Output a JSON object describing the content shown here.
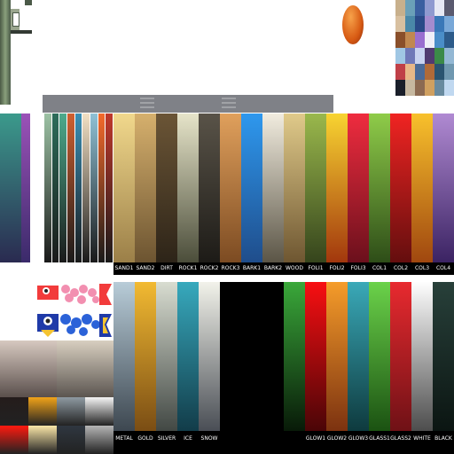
{
  "top_palette": {
    "labels": [
      "SAND1",
      "SAND2",
      "DIRT",
      "ROCK1",
      "ROCK2",
      "ROCK3",
      "BARK1",
      "BARK2",
      "WOOD",
      "FOLI1",
      "FOLI2",
      "FOLI3",
      "COL1",
      "COL2",
      "COL3",
      "COL4"
    ],
    "gradients": [
      [
        "#f1d88c",
        "#9b7f48"
      ],
      [
        "#d6b06d",
        "#6c5431"
      ],
      [
        "#6b5536",
        "#2d2418"
      ],
      [
        "#e6e4c9",
        "#4b4d3a"
      ],
      [
        "#595348",
        "#1d1b17"
      ],
      [
        "#e0a05c",
        "#7c4b22"
      ],
      [
        "#2e98ee",
        "#1f4d8b"
      ],
      [
        "#f1ecdf",
        "#5b5546"
      ],
      [
        "#e0ca8a",
        "#6e5631"
      ],
      [
        "#9ab84c",
        "#35441c"
      ],
      [
        "#f8d431",
        "#a2370d"
      ],
      [
        "#ef2c3f",
        "#6b101c"
      ],
      [
        "#8fcc49",
        "#2e4d18"
      ],
      [
        "#f02422",
        "#640e0e"
      ],
      [
        "#f8c12c",
        "#a0470f"
      ],
      [
        "#b08ad2",
        "#3b2363"
      ]
    ]
  },
  "bottom_left_palette": {
    "labels": [
      "METAL",
      "GOLD",
      "SILVER",
      "ICE",
      "SNOW"
    ],
    "gradients": [
      [
        "#b8ccd8",
        "#3d4750"
      ],
      [
        "#f2ba32",
        "#7a4d14"
      ],
      [
        "#d8dcd0",
        "#424844"
      ],
      [
        "#37a9bd",
        "#123c49"
      ],
      [
        "#f2f2ea",
        "#4a4e55"
      ]
    ]
  },
  "bottom_right_palette": {
    "labels": [
      "GLOW1",
      "GLOW2",
      "GLOW3",
      "GLASS1",
      "GLASS2",
      "WHITE",
      "BLACK"
    ],
    "gradients": [
      [
        "#f80f12",
        "#4a0507"
      ],
      [
        "#f59c2a",
        "#7c3210"
      ],
      [
        "#3aa9b8",
        "#0e3a3e"
      ],
      [
        "#6bd24a",
        "#1b5212"
      ],
      [
        "#e82a2f",
        "#6f1116"
      ],
      [
        "#fefefe",
        "#4d4d4d"
      ],
      [
        "#28403a",
        "#0b1512"
      ]
    ]
  },
  "left_block_gradients": [
    [
      "#3b9a8c",
      "#2a2a50"
    ],
    [
      "#9b52b8",
      "#3a2a6a"
    ]
  ],
  "strip_colors": [
    "#9cc2a4",
    "#2c6d5a",
    "#4daa8c",
    "#d06030",
    "#3a8fb5",
    "#f2e0c4",
    "#8fc1d6",
    "#f46a2b",
    "#c0392b"
  ],
  "bottom_swatches": [
    [
      "#241c1b",
      "#f1a319",
      "#8e9aa2",
      "#f5f5f5"
    ],
    [
      "#ff1a0f",
      "#fbe7a8",
      "#2f3740",
      "#b6b6b6"
    ]
  ],
  "header_bar_color": "#7f8187",
  "mosaic_colors": [
    "#c8b08c",
    "#6aa0b8",
    "#3a5fa0",
    "#8f9ad0",
    "#e6e8f4",
    "#5a5a6f",
    "#d8c0a0",
    "#4a88a8",
    "#2a4a88",
    "#a48ccf",
    "#3a78b8",
    "#79a8d8",
    "#8a4f2a",
    "#c08850",
    "#9a6fd0",
    "#f0f0f8",
    "#4a8ec8",
    "#2d5b8a",
    "#a0c7e4",
    "#6f78b8",
    "#c8d2f0",
    "#503a70",
    "#3b8a48",
    "#94b8d4",
    "#c04048",
    "#e8b888",
    "#4a6a98",
    "#b06a38",
    "#2a5470",
    "#7098b0",
    "#1a1f2a",
    "#c6b8a0",
    "#8c6a52",
    "#d0a060",
    "#688a9f",
    "#c0d8f0"
  ]
}
